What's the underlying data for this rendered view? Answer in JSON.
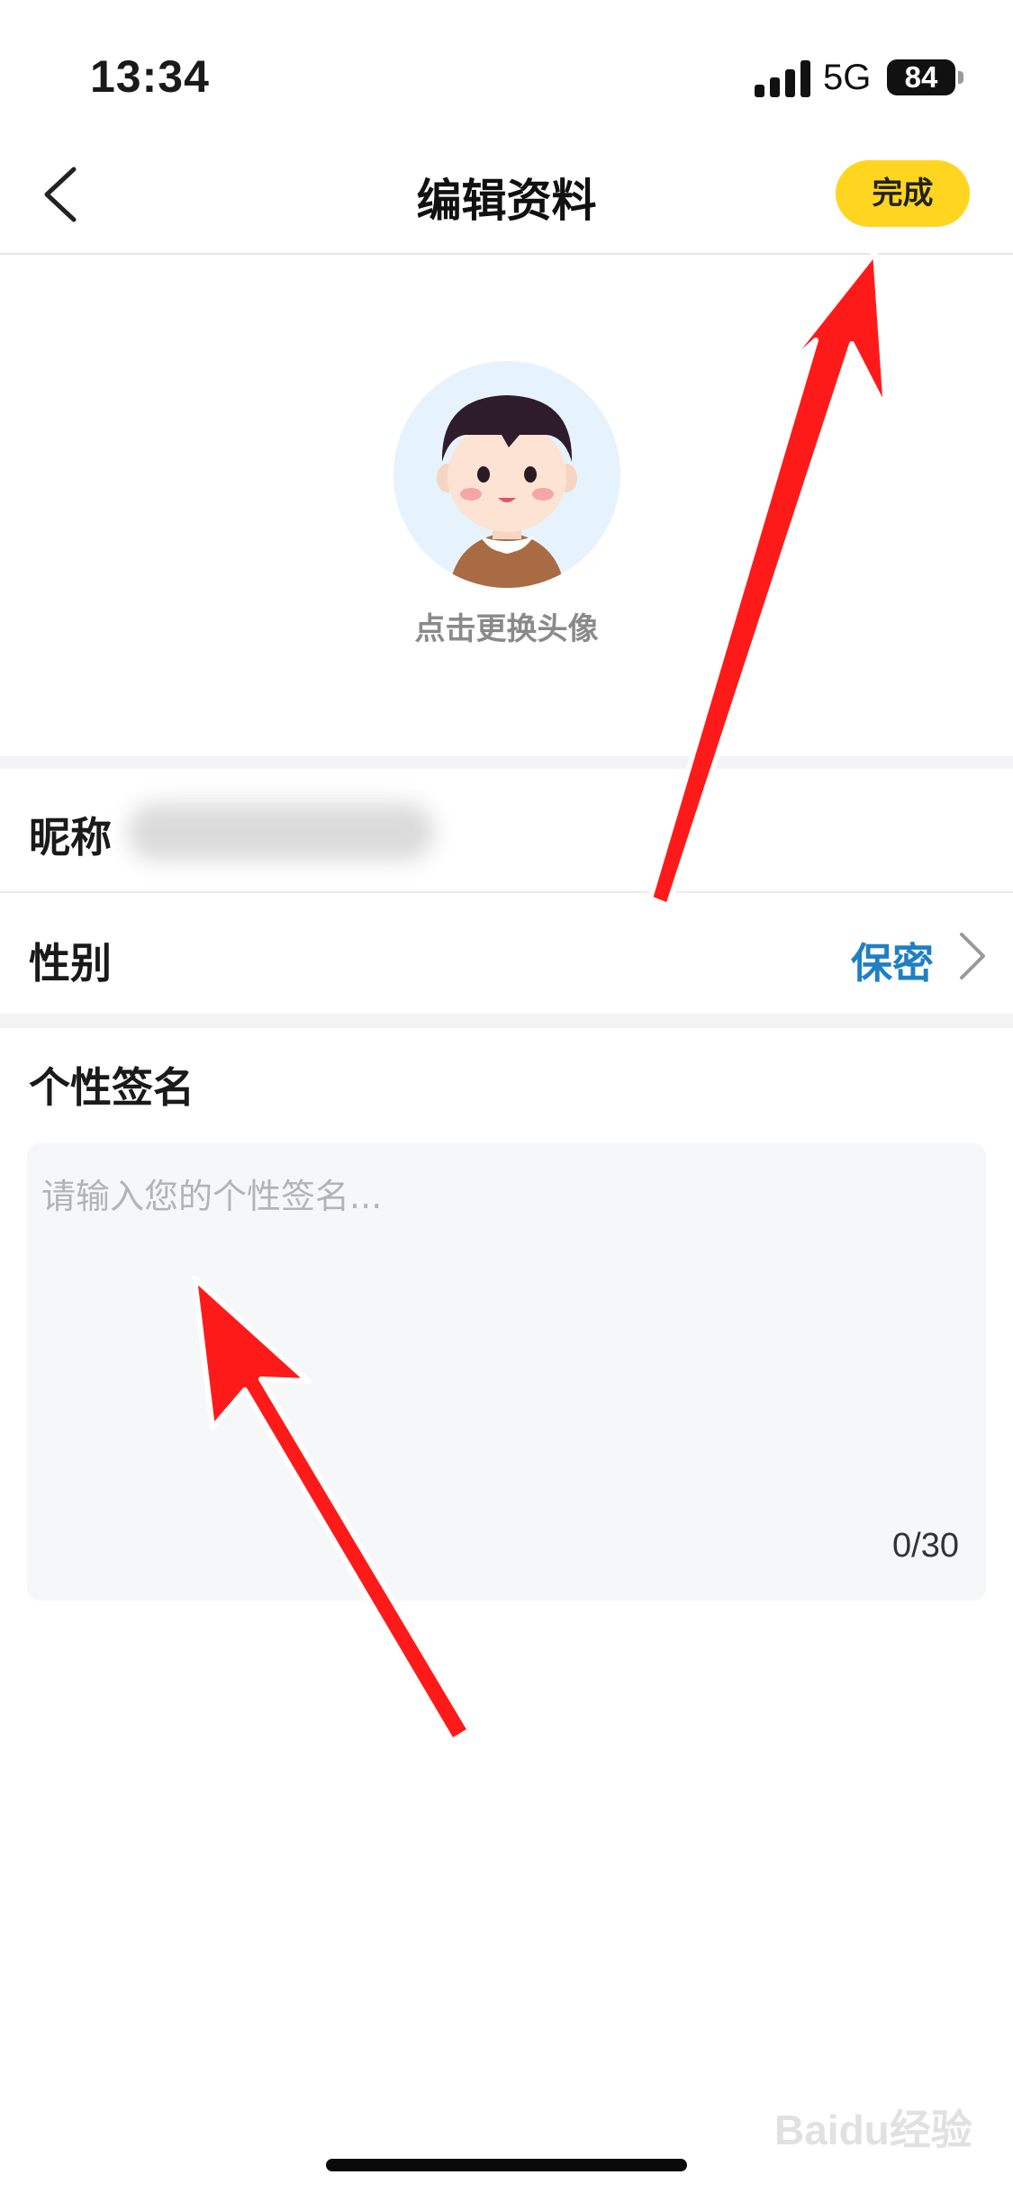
{
  "status_bar": {
    "time": "13:34",
    "network": "5G",
    "battery": "84"
  },
  "nav": {
    "title": "编辑资料",
    "done_label": "完成",
    "back_icon": "chevron-left-icon"
  },
  "avatar": {
    "hint": "点击更换头像"
  },
  "nickname": {
    "label": "昵称"
  },
  "gender": {
    "label": "性别",
    "value": "保密"
  },
  "signature": {
    "label": "个性签名",
    "placeholder": "请输入您的个性签名...",
    "counter": "0/30"
  },
  "watermark": {
    "text": "Baidu经验"
  },
  "colors": {
    "accent": "#ffd51f",
    "link": "#1f7fc4",
    "annotation_arrow": "#ff1a1a"
  }
}
